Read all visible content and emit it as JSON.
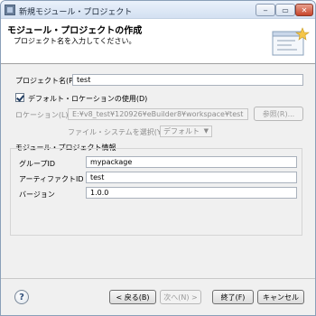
{
  "window": {
    "title": "新規モジュール・プロジェクト",
    "min": "‒",
    "max": "▭",
    "close": "✕"
  },
  "banner": {
    "title": "モジュール・プロジェクトの作成",
    "description": "プロジェクト名を入力してください。"
  },
  "project": {
    "name_label": "プロジェクト名(P):",
    "name_value": "test"
  },
  "location": {
    "use_default_label": "デフォルト・ロケーションの使用(D)",
    "use_default_checked": true,
    "location_label": "ロケーション(L):",
    "location_value": "E:¥v8_test¥120926¥eBuilder8¥workspace¥test",
    "browse_label": "参照(R)...",
    "filesystem_label": "ファイル・システムを選択(Y):",
    "filesystem_value": "デフォルト"
  },
  "module_info": {
    "heading": "モジュール・プロジェクト情報",
    "group_id_label": "グループID",
    "group_id_value": "mypackage",
    "artifact_id_label": "アーティファクトID",
    "artifact_id_value": "test",
    "version_label": "バージョン",
    "version_value": "1.0.0"
  },
  "footer": {
    "help": "?",
    "back": "< 戻る(B)",
    "next": "次へ(N) >",
    "finish": "終了(F)",
    "cancel": "キャンセル"
  }
}
